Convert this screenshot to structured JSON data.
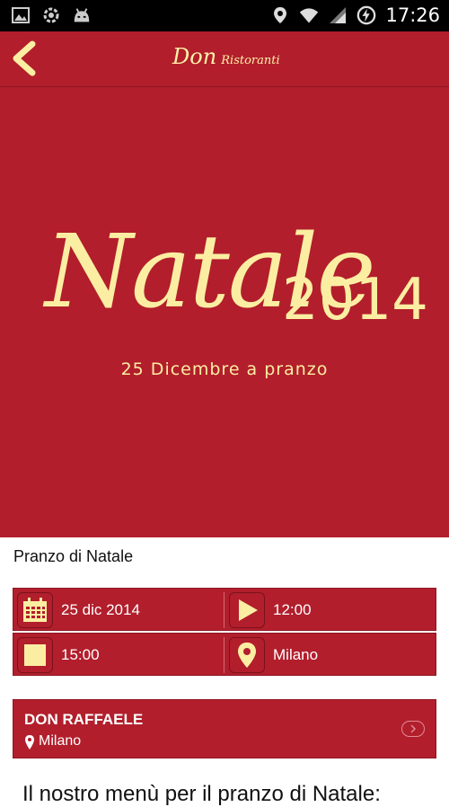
{
  "status_bar": {
    "time": "17:26"
  },
  "app_bar": {
    "brand_main": "Don",
    "brand_sub": "Ristoranti"
  },
  "hero": {
    "title": "Natale",
    "year": "2014",
    "subtitle": "25 Dicembre a pranzo"
  },
  "event": {
    "title": "Pranzo di Natale",
    "date": "25 dic 2014",
    "start_time": "12:00",
    "end_time": "15:00",
    "city": "Milano"
  },
  "restaurant": {
    "name": "DON RAFFAELE",
    "city": "Milano"
  },
  "menu_heading": "Il nostro menù per il pranzo di Natale:",
  "colors": {
    "brand_red": "#b21e2c",
    "accent_cream": "#fbeea2"
  }
}
